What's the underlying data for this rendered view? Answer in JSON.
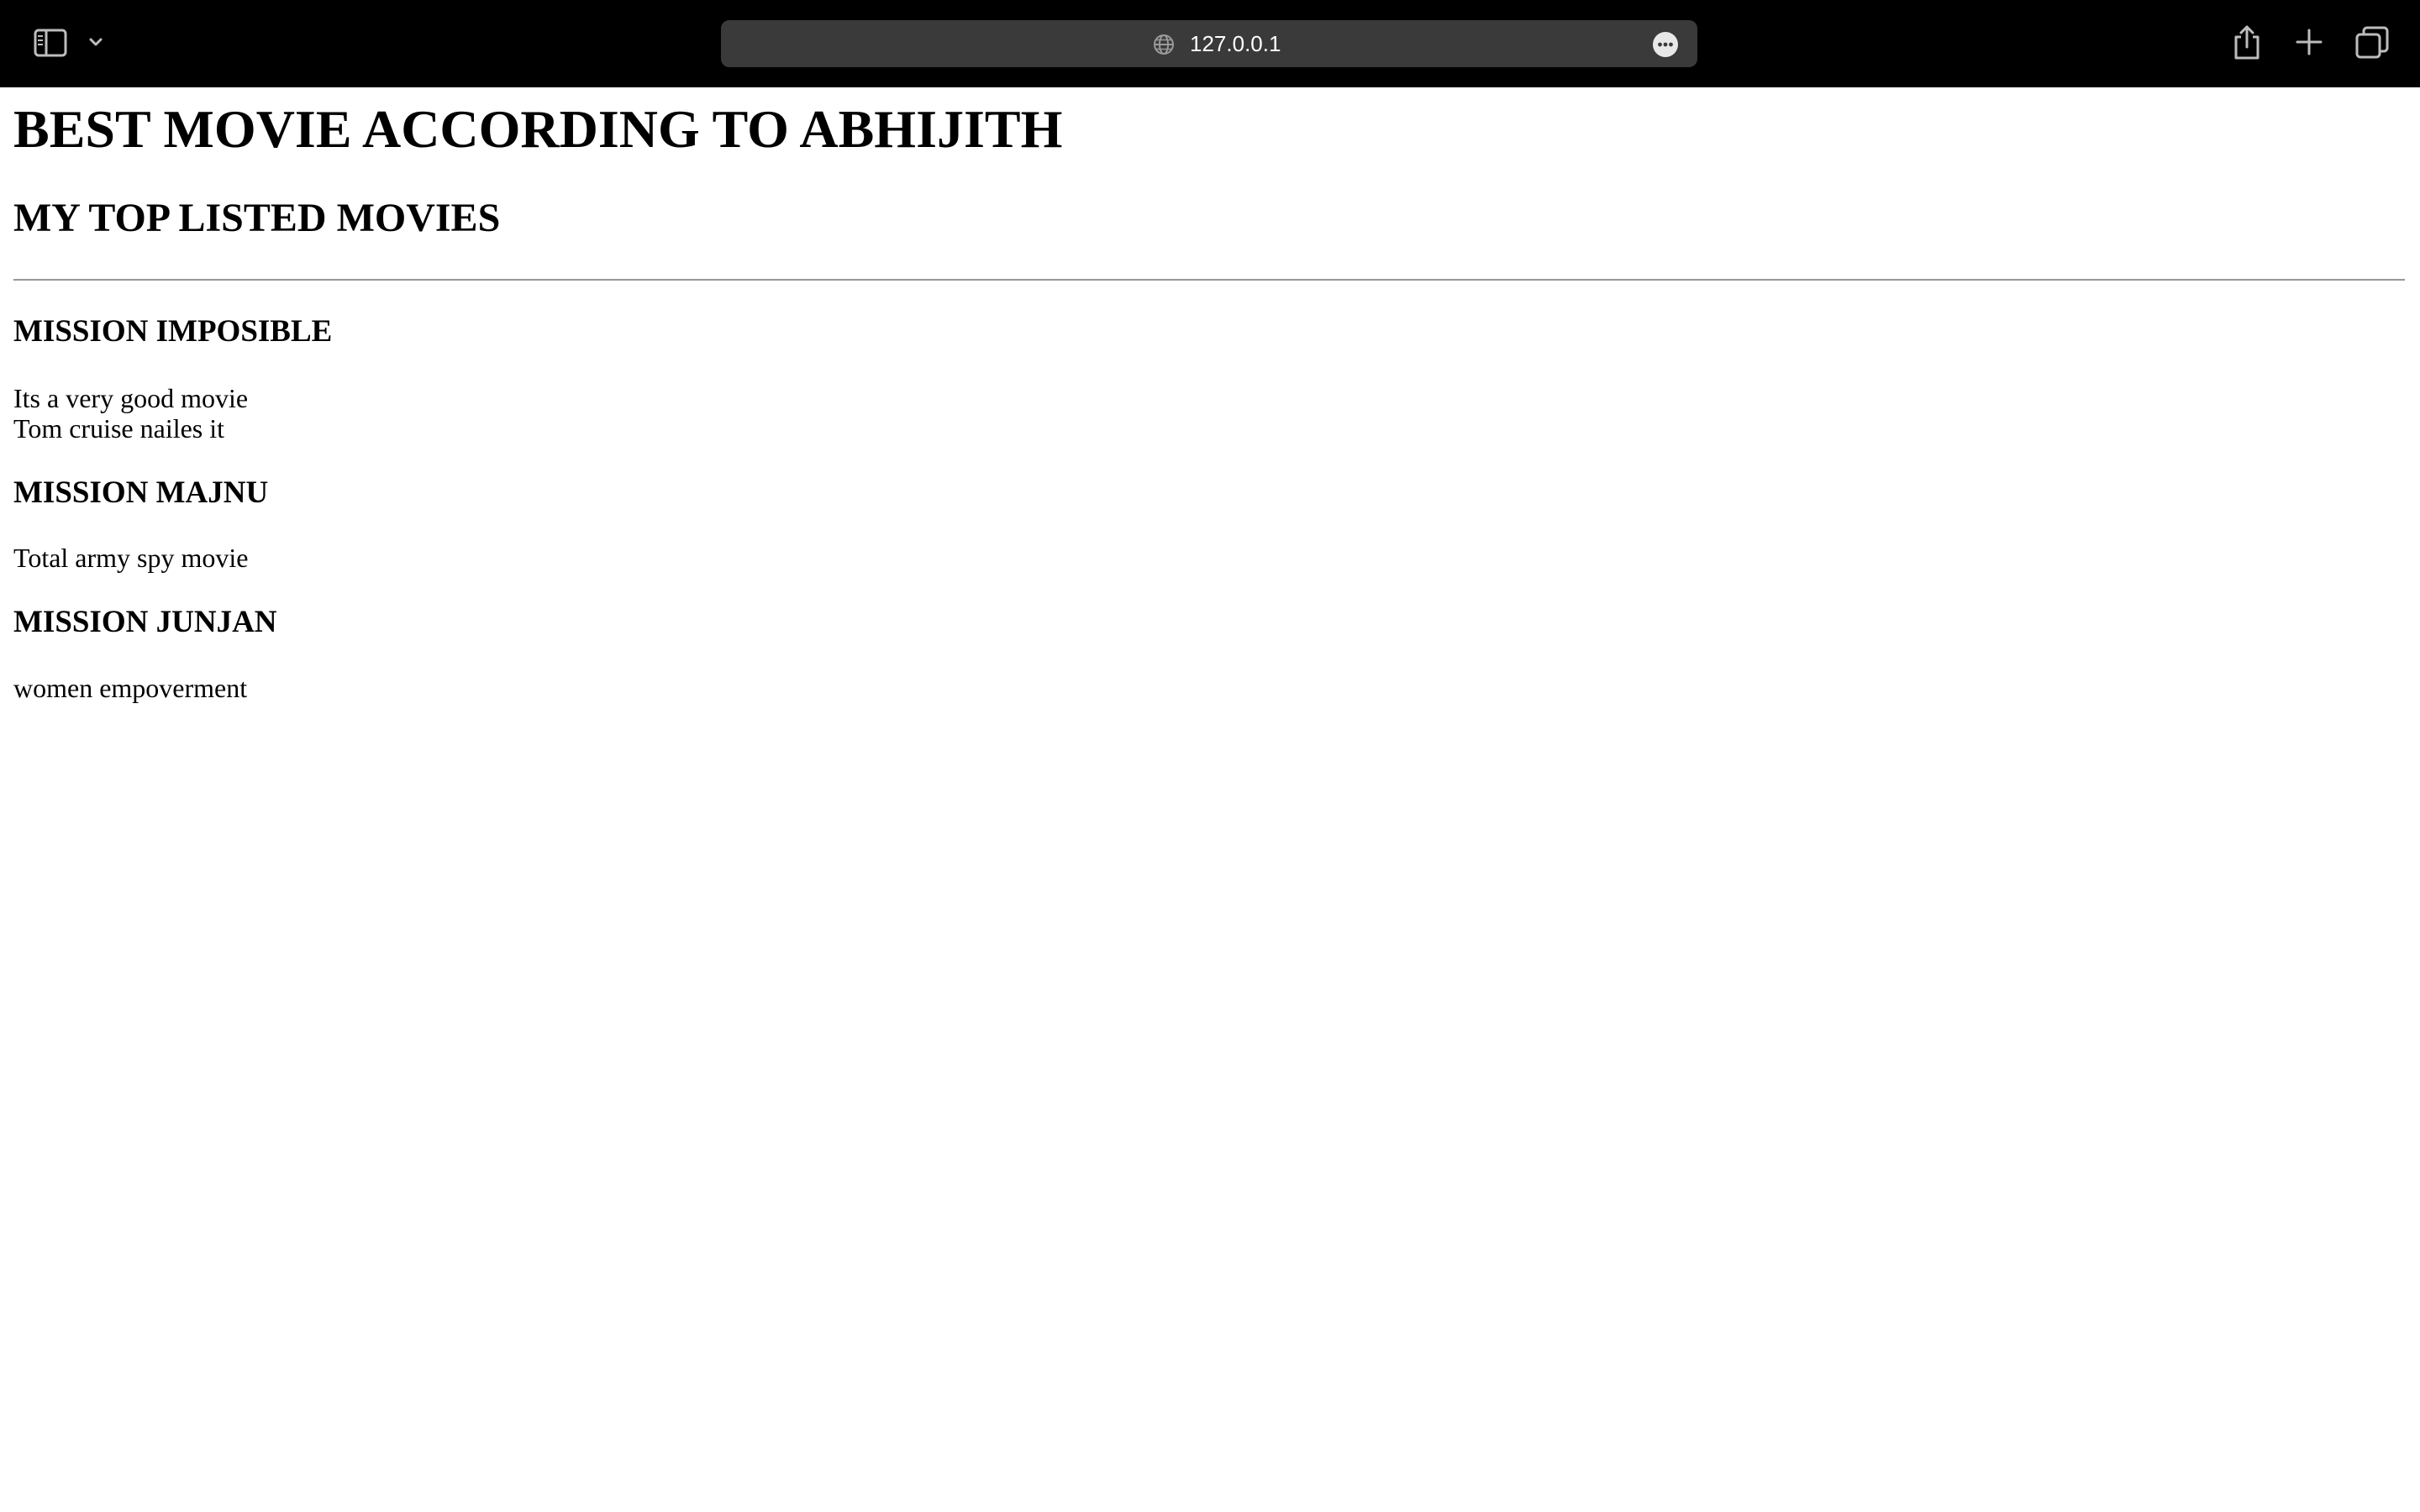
{
  "browser": {
    "url": "127.0.0.1",
    "icons": [
      "sidebar-icon",
      "chevron-down-icon",
      "globe-icon",
      "more-icon",
      "share-icon",
      "plus-icon",
      "tabs-icon"
    ]
  },
  "page": {
    "heading": "BEST MOVIE ACCORDING TO ABHIJITH",
    "subheading": "MY TOP LISTED MOVIES",
    "movies": [
      {
        "title": "MISSION IMPOSIBLE",
        "lines": [
          "Its a very good movie",
          "Tom cruise nailes it"
        ]
      },
      {
        "title": "MISSION MAJNU",
        "lines": [
          "Total army spy movie"
        ]
      },
      {
        "title": "MISSION JUNJAN",
        "lines": [
          "women empoverment"
        ]
      }
    ]
  }
}
